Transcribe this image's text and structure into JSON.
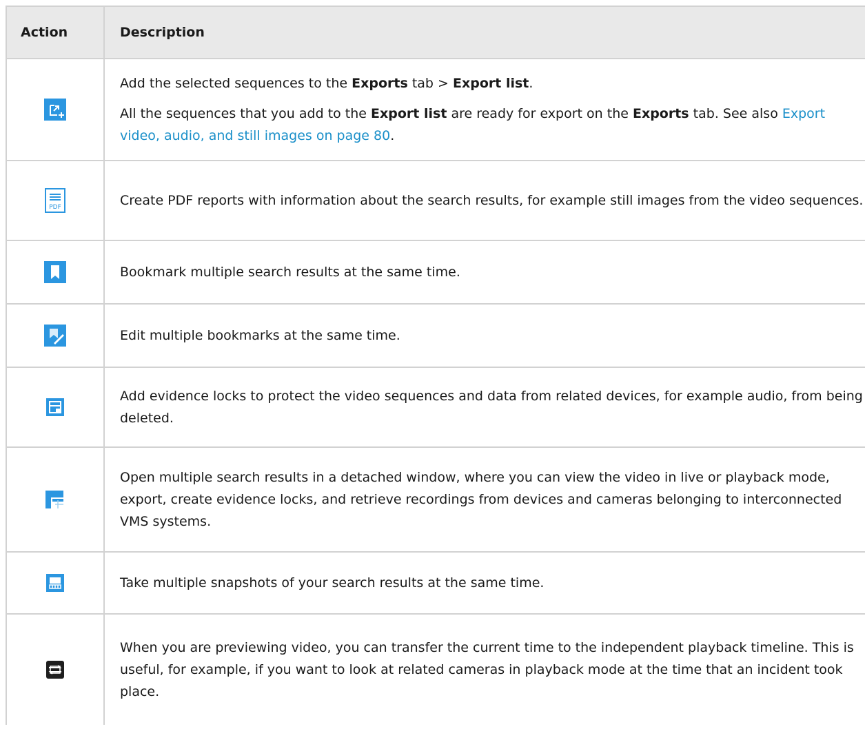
{
  "table": {
    "headers": {
      "action": "Action",
      "description": "Description"
    },
    "rows": [
      {
        "icon": "add-to-export-list-icon",
        "p1": {
          "t1": "Add the selected sequences to the ",
          "b1": "Exports",
          "t2": " tab > ",
          "b2": "Export list",
          "t3": "."
        },
        "p2": {
          "t1": "All the sequences that you add to the ",
          "b1": "Export list",
          "t2": " are ready for export on the ",
          "b2": "Exports",
          "t3": " tab. See also ",
          "link": "Export video, audio, and still images on page 80",
          "t4": "."
        }
      },
      {
        "icon": "pdf-report-icon",
        "text": "Create PDF reports with information about the search results, for example still images from the video sequences."
      },
      {
        "icon": "bookmark-icon",
        "text": "Bookmark multiple search results at the same time."
      },
      {
        "icon": "edit-bookmark-icon",
        "text": "Edit multiple bookmarks at the same time."
      },
      {
        "icon": "evidence-lock-icon",
        "text": "Add evidence locks to protect the video sequences and data from related devices, for example audio, from being deleted."
      },
      {
        "icon": "detached-window-icon",
        "text": "Open multiple search results in a detached window, where you can view the video in live or playback mode, export, create evidence locks, and retrieve recordings from devices and cameras belonging to interconnected VMS systems."
      },
      {
        "icon": "snapshot-icon",
        "text": "Take multiple snapshots of your search results at the same time."
      },
      {
        "icon": "transfer-time-icon",
        "text": "When you are previewing video, you can transfer the current time to the independent playback timeline. This is useful, for example, if you want to look at related cameras in playback mode at the time that an incident took place."
      }
    ]
  },
  "colors": {
    "accent": "#2b96e0",
    "link": "#1a8fc9",
    "header_bg": "#e9e9e9",
    "border": "#d2d2d2"
  }
}
